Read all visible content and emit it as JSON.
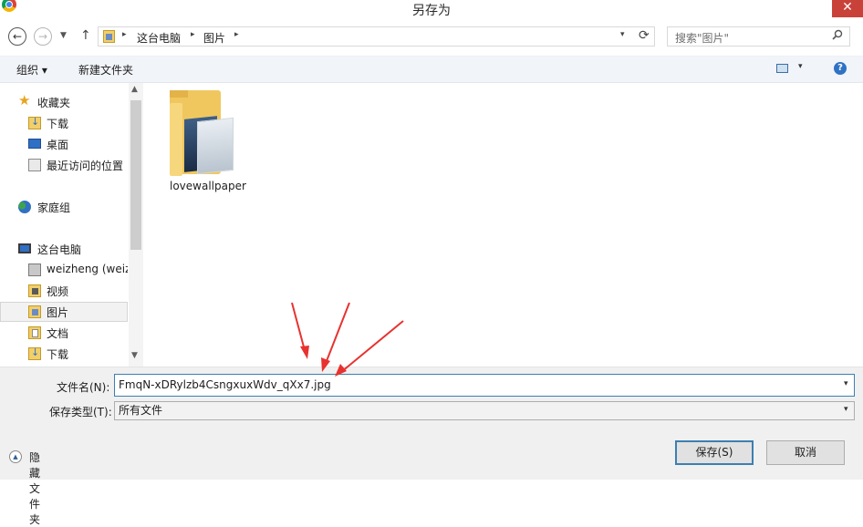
{
  "window": {
    "title": "另存为",
    "close_glyph": "✕"
  },
  "nav_buttons": {
    "back": "←",
    "forward": "→",
    "history": "▼",
    "up": "↑"
  },
  "address": {
    "crumbs": [
      "这台电脑",
      "图片"
    ],
    "sep": "▸",
    "dropdown": "▾",
    "refresh": "⟳"
  },
  "search": {
    "placeholder": "搜索\"图片\"",
    "icon": "search-icon"
  },
  "toolbar": {
    "organize_label": "组织 ▾",
    "new_folder_label": "新建文件夹",
    "view_dd": "▾",
    "help": "?"
  },
  "sidebar": {
    "items": [
      {
        "label": "收藏夹",
        "icon": "star-icon"
      },
      {
        "label": "下载",
        "icon": "download-folder-icon"
      },
      {
        "label": "桌面",
        "icon": "desktop-icon"
      },
      {
        "label": "最近访问的位置",
        "icon": "recent-places-icon"
      },
      {
        "label": "家庭组",
        "icon": "homegroup-icon"
      },
      {
        "label": "这台电脑",
        "icon": "computer-icon"
      },
      {
        "label": "weizheng (weizl",
        "icon": "network-drive-icon"
      },
      {
        "label": "视频",
        "icon": "videos-folder-icon"
      },
      {
        "label": "图片",
        "icon": "pictures-folder-icon",
        "selected": true
      },
      {
        "label": "文档",
        "icon": "documents-folder-icon"
      },
      {
        "label": "下载",
        "icon": "download-folder-icon"
      }
    ],
    "scroll_up": "▲",
    "scroll_down": "▼"
  },
  "files": [
    {
      "name": "lovewallpaper",
      "icon": "image-folder-icon"
    }
  ],
  "form": {
    "filename_label": "文件名(N):",
    "filename_value": "FmqN-xDRylzb4CsngxuxWdv_qXx7.jpg",
    "filetype_label": "保存类型(T):",
    "filetype_value": "所有文件",
    "dd": "▾"
  },
  "footer": {
    "hide_folders_label": "隐藏文件夹",
    "hide_glyph": "▲"
  },
  "buttons": {
    "save_label": "保存(S)",
    "cancel_label": "取消"
  },
  "colors": {
    "accent": "#3c7fb1",
    "annotation_arrow": "#e8322f",
    "close_button": "#c9423a",
    "selection_bg": "#f2f2f2"
  }
}
